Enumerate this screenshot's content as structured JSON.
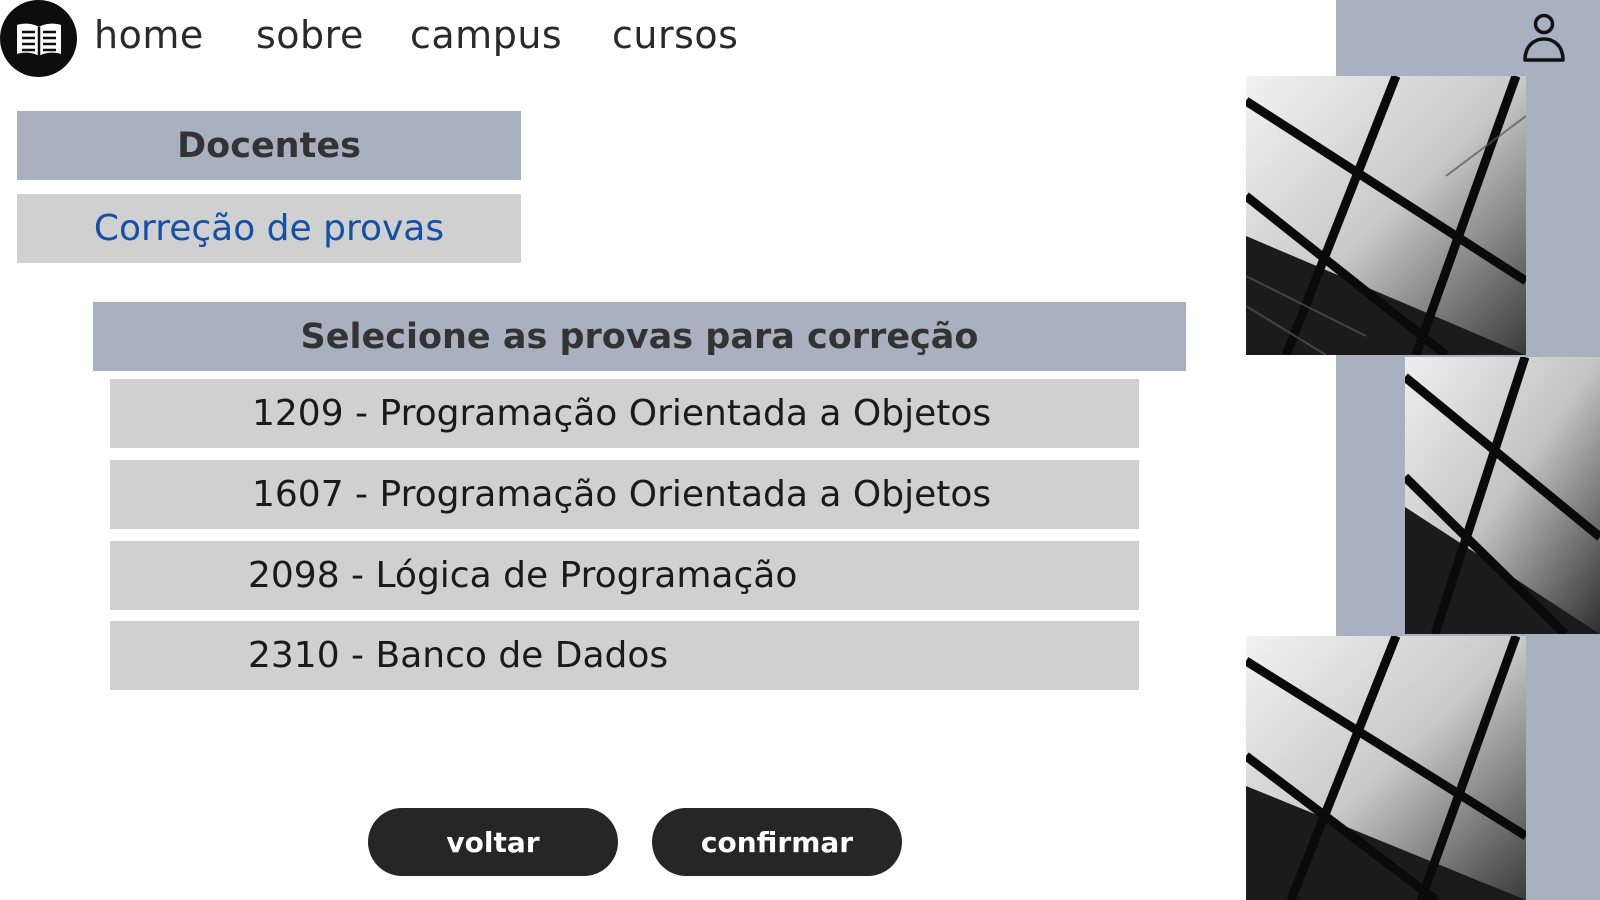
{
  "nav": {
    "items": [
      {
        "label": "home"
      },
      {
        "label": "sobre"
      },
      {
        "label": "campus"
      },
      {
        "label": "cursos"
      }
    ]
  },
  "sidebar_labels": {
    "section": "Docentes",
    "page": "Correção de provas"
  },
  "selection": {
    "title": "Selecione as provas para correção",
    "exams": [
      {
        "label": "1209 - Programação Orientada a Objetos"
      },
      {
        "label": "1607 - Programação Orientada a Objetos"
      },
      {
        "label": "2098 - Lógica de Programação"
      },
      {
        "label": "2310 - Banco de Dados"
      }
    ]
  },
  "buttons": {
    "back": "voltar",
    "confirm": "confirmar"
  },
  "icons": {
    "logo": "book-icon",
    "user": "user-icon"
  },
  "colors": {
    "panel": "#a9b0bf",
    "item_bg": "#d0d0d0",
    "link_blue": "#1451a6",
    "button_bg": "#262626"
  }
}
